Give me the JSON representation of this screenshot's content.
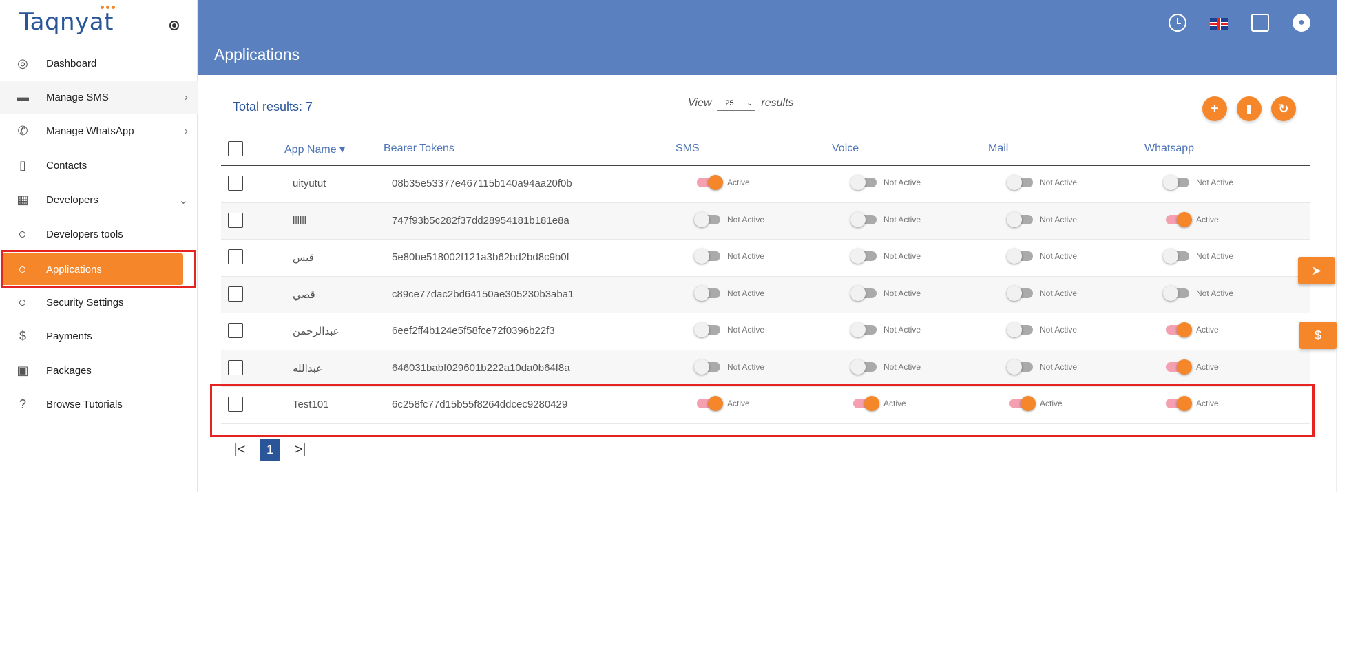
{
  "brand": {
    "name": "Taqnyat"
  },
  "sidebar": {
    "items": [
      {
        "label": "Dashboard",
        "icon": "palette-icon"
      },
      {
        "label": "Manage SMS",
        "icon": "message-icon",
        "chevron": ">"
      },
      {
        "label": "Manage WhatsApp",
        "icon": "whatsapp-icon",
        "chevron": ">"
      },
      {
        "label": "Contacts",
        "icon": "book-icon"
      },
      {
        "label": "Developers",
        "icon": "developer-icon",
        "chevron": "v"
      },
      {
        "label": "Developers tools"
      },
      {
        "label": "Applications"
      },
      {
        "label": "Security Settings"
      },
      {
        "label": "Payments",
        "icon": "dollar-icon"
      },
      {
        "label": "Packages",
        "icon": "package-icon"
      },
      {
        "label": "Browse Tutorials",
        "icon": "help-icon"
      }
    ]
  },
  "header": {
    "title": "Applications"
  },
  "toolbar": {
    "total": "Total results: 7",
    "view_label": "View",
    "view_value": "25",
    "results_label": "results"
  },
  "table": {
    "columns": [
      "App Name",
      "Bearer Tokens",
      "SMS",
      "Voice",
      "Mail",
      "Whatsapp"
    ],
    "sort_indicator": "▾",
    "rows": [
      {
        "name": "uityutut",
        "token": "08b35e53377e467115b140a94aa20f0b",
        "sms": "Active",
        "voice": "Not Active",
        "mail": "Not Active",
        "whatsapp": "Not Active"
      },
      {
        "name": "llllll",
        "token": "747f93b5c282f37dd28954181b181e8a",
        "sms": "Not Active",
        "voice": "Not Active",
        "mail": "Not Active",
        "whatsapp": "Active"
      },
      {
        "name": "قيس",
        "token": "5e80be518002f121a3b62bd2bd8c9b0f",
        "sms": "Not Active",
        "voice": "Not Active",
        "mail": "Not Active",
        "whatsapp": "Not Active"
      },
      {
        "name": "قصي",
        "token": "c89ce77dac2bd64150ae305230b3aba1",
        "sms": "Not Active",
        "voice": "Not Active",
        "mail": "Not Active",
        "whatsapp": "Not Active"
      },
      {
        "name": "عبدالرحمن",
        "token": "6eef2ff4b124e5f58fce72f0396b22f3",
        "sms": "Not Active",
        "voice": "Not Active",
        "mail": "Not Active",
        "whatsapp": "Active"
      },
      {
        "name": "عبدالله",
        "token": "646031babf029601b222a10da0b64f8a",
        "sms": "Not Active",
        "voice": "Not Active",
        "mail": "Not Active",
        "whatsapp": "Active"
      },
      {
        "name": "Test101",
        "token": "6c258fc77d15b55f8264ddcec9280429",
        "sms": "Active",
        "voice": "Active",
        "mail": "Active",
        "whatsapp": "Active"
      }
    ]
  },
  "pager": {
    "first": "|<",
    "current": "1",
    "last": ">|"
  },
  "colors": {
    "accent": "#f5862a",
    "header": "#5b80c0",
    "highlight": "#e52421"
  }
}
